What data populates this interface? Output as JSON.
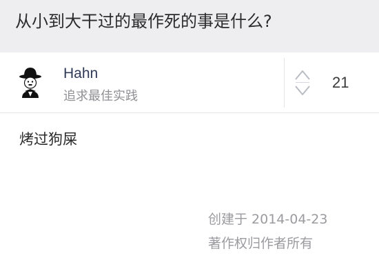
{
  "question": {
    "title": "从小到大干过的最作死的事是什么?"
  },
  "author": {
    "name": "Hahn",
    "bio": "追求最佳实践",
    "avatar_icon": "bowler-hat-man-icon"
  },
  "vote": {
    "count": "21",
    "icon": "vote-up-down-icon"
  },
  "answer": {
    "text": "烤过狗屎"
  },
  "meta": {
    "created": "创建于 2014-04-23",
    "copyright": "著作权归作者所有"
  },
  "colors": {
    "header_bg": "#eeeef1",
    "author_name": "#2f3b56",
    "muted_text": "#9a9a9f"
  }
}
